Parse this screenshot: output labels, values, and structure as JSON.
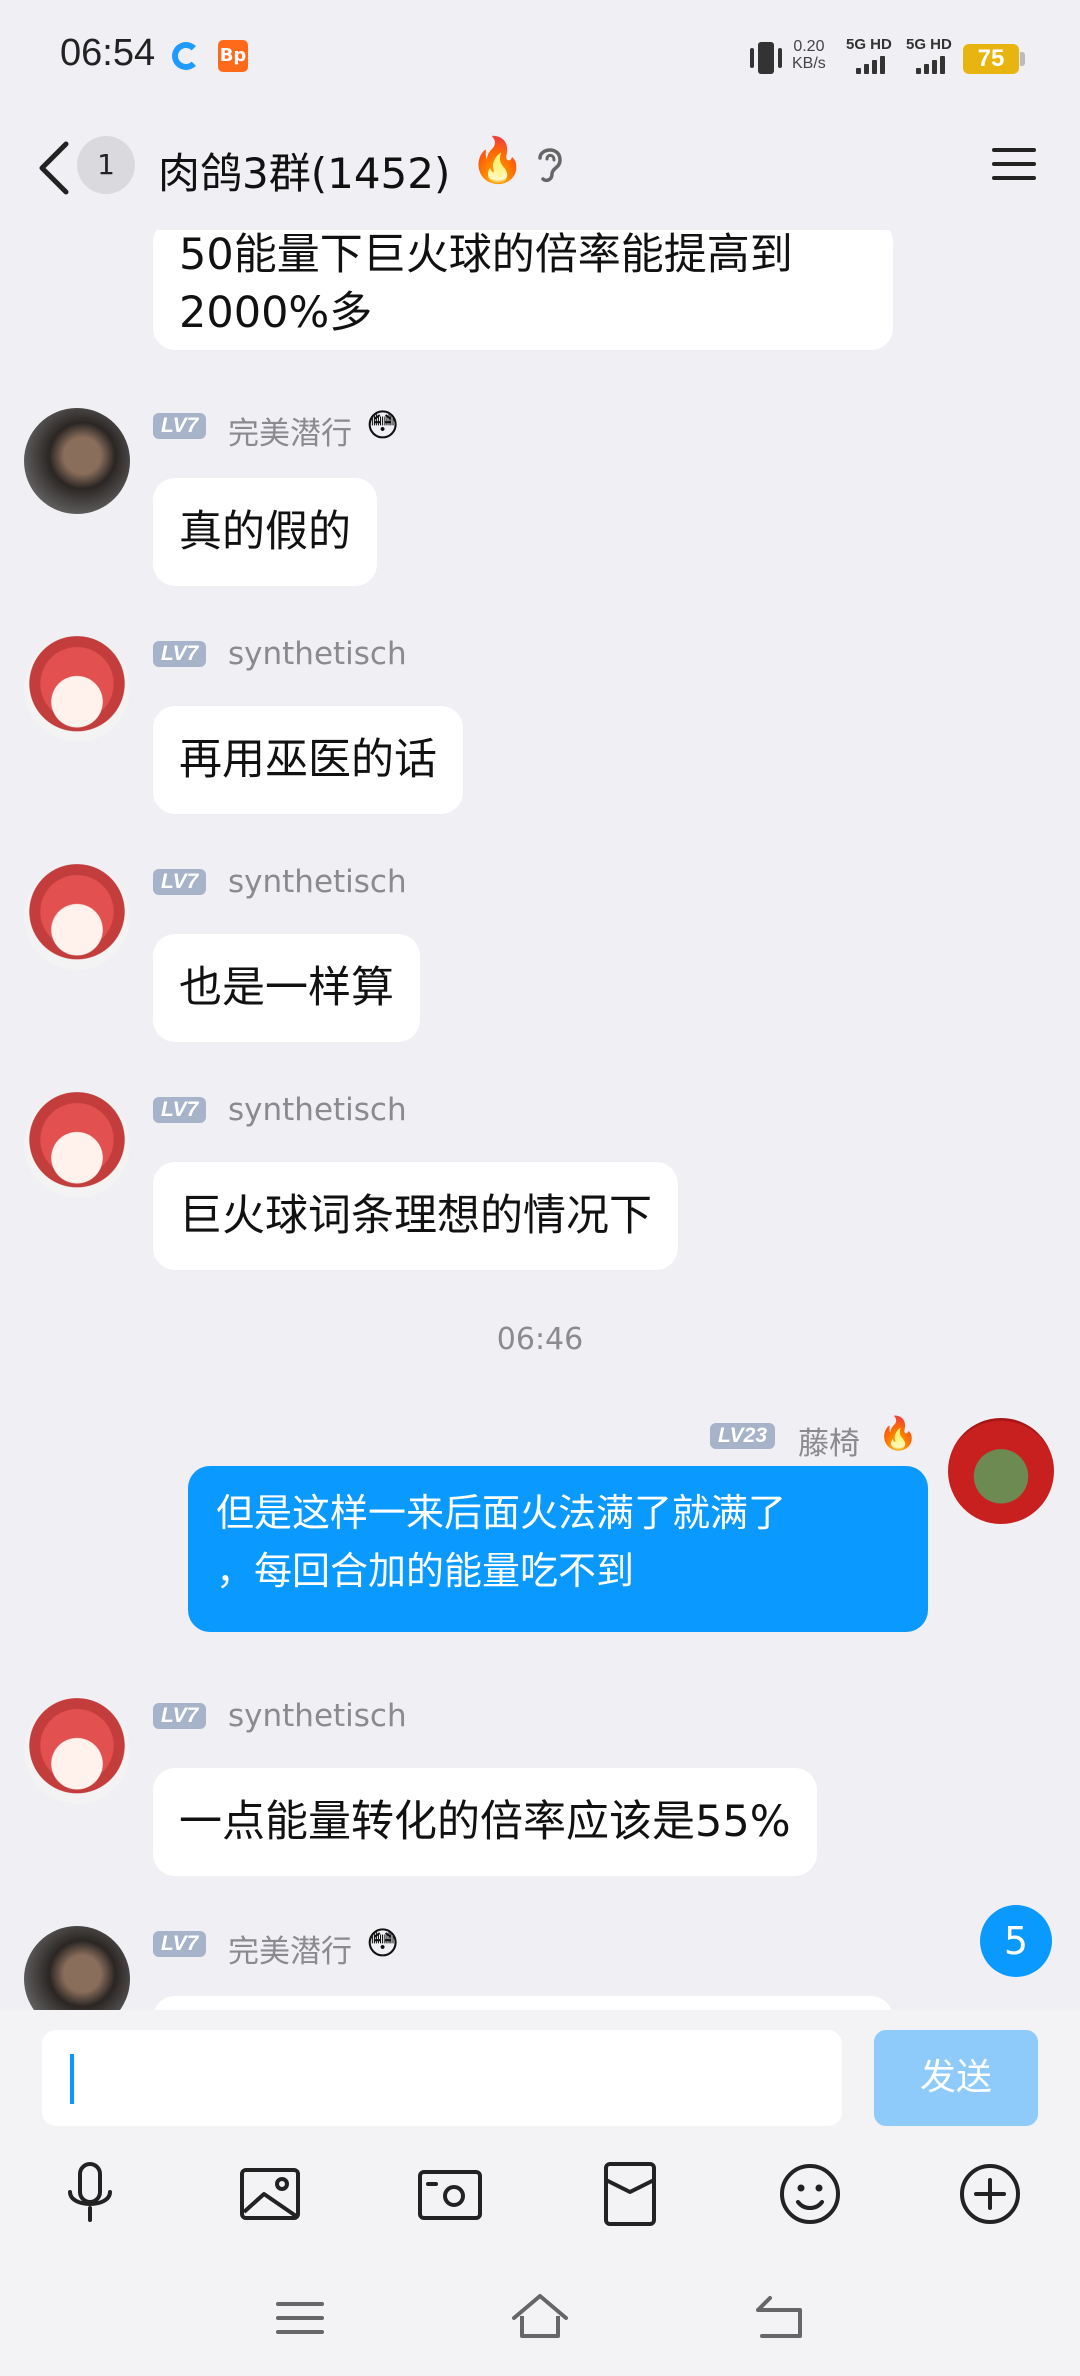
{
  "status_bar": {
    "time": "06:54",
    "app2_label": "Bp",
    "speed_value": "0.20",
    "speed_unit": "KB/s",
    "net1": "5G HD",
    "net2": "5G HD",
    "battery": "75"
  },
  "header": {
    "unread_badge": "1",
    "title": "肉鸽3群(1452)",
    "fire": "🔥"
  },
  "messages": [
    {
      "text_line1": "50能量下巨火球的倍率能提高到",
      "text_line2": "2000%多"
    },
    {
      "level": "LV7",
      "nick": "完美潜行",
      "emoji": "😳",
      "text": "真的假的"
    },
    {
      "level": "LV7",
      "nick": "synthetisch",
      "text": "再用巫医的话"
    },
    {
      "level": "LV7",
      "nick": "synthetisch",
      "text": "也是一样算"
    },
    {
      "level": "LV7",
      "nick": "synthetisch",
      "text": "巨火球词条理想的情况下"
    },
    {
      "timestamp": "06:46"
    },
    {
      "level": "LV23",
      "nick": "藤椅",
      "emoji": "🔥",
      "text_line1": "但是这样一来后面火法满了就满了",
      "text_line2": "，每回合加的能量吃不到"
    },
    {
      "level": "LV7",
      "nick": "synthetisch",
      "text": "一点能量转化的倍率应该是55%"
    },
    {
      "level": "LV7",
      "nick": "完美潜行",
      "emoji": "😳"
    }
  ],
  "unread_count": "5",
  "composer": {
    "placeholder": "",
    "send_label": "发送"
  },
  "colors": {
    "accent": "#0a99ff",
    "send_disabled": "#8ecbfb",
    "background": "#efeff4",
    "level_badge": "#a7b3c8"
  },
  "toolbar_icons": [
    "microphone-icon",
    "image-icon",
    "camera-icon",
    "red-packet-icon",
    "emoji-icon",
    "plus-icon"
  ]
}
